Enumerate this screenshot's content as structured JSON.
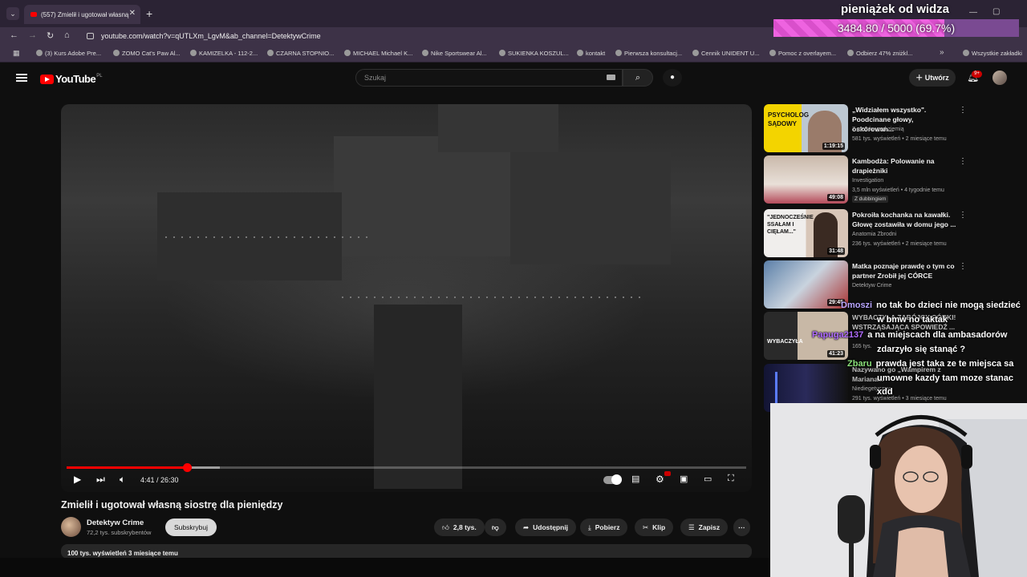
{
  "browser": {
    "tab_title": "(557) Zmielił i ugotował własną",
    "url": "youtube.com/watch?v=qUTLXm_LgvM&ab_channel=DetektywCrime",
    "bookmarks": [
      "(3) Kurs Adobe Pre...",
      "ZOMO Cat's Paw Al...",
      "KAMIZELKA - 112-2...",
      "CZARNA STOPNIO...",
      "MICHAEL Michael K...",
      "Nike Sportswear Al...",
      "SUKIENKA KOSZUL...",
      "kontakt",
      "Pierwsza konsultacj...",
      "Cennik UNIDENT U...",
      "Pomoc z overlayem...",
      "Odbierz 47% zniżkl...",
      "Wszystkie zakładki"
    ]
  },
  "overlay": {
    "title": "pieniążek od widza",
    "progress_text": "3484.80 / 5000 (69.7%)",
    "progress": 0.697
  },
  "youtube": {
    "logo": "YouTube",
    "region": "PL",
    "search_placeholder": "Szukaj",
    "create_label": "Utwórz",
    "notif_count": "9+"
  },
  "player": {
    "time": "4:41 / 26:30",
    "progress": 0.177,
    "buffered": 0.225
  },
  "video": {
    "title": "Zmielił i ugotował własną siostrę dla pieniędzy",
    "channel": "Detektyw Crime",
    "subs": "72,2 tys. subskrybentów",
    "subscribe_label": "Subskrybuj",
    "likes": "2,8 tys.",
    "share_label": "Udostępnij",
    "download_label": "Pobierz",
    "clip_label": "Klip",
    "save_label": "Zapisz",
    "desc_meta": "100 tys. wyświetleń  3 miesiące temu"
  },
  "recommendations": [
    {
      "title": "„Widziałem wszystko\". Poodcinane głowy, oskórowan...",
      "channel": "7 metrów pod ziemią",
      "meta": "581 tys. wyświetleń • 2 miesiące temu",
      "duration": "1:19:15",
      "thumb_text": "PSYCHOLOG SĄDOWY"
    },
    {
      "title": "Kambodża: Polowanie na drapieżniki",
      "channel": "Investigation",
      "meta": "3,5 mln wyświetleń • 4 tygodnie temu",
      "duration": "49:08",
      "dubbed": "Z dubbingiem"
    },
    {
      "title": "Pokroiła kochanka na kawałki. Głowę zostawiła w domu jego ...",
      "channel": "Anatomia Zbrodni",
      "meta": "236 tys. wyświetleń • 2 miesiące temu",
      "duration": "31:48",
      "thumb_text": "\"JEDNOCZEŚNIE SSAŁAM I CIĘŁAM...\""
    },
    {
      "title": "Matka poznaje prawdę o tym co partner Zrobił jej CÓRCE",
      "channel": "Detektyw Crime",
      "meta": "",
      "duration": "29:45"
    },
    {
      "title": "WYBACZYŁA ZABÓJCY CÓRKI! WSTRZĄSAJĄCA SPOWIEDŹ ...",
      "channel": "",
      "meta": "165 tys.",
      "duration": "41:23",
      "thumb_text": "WYBACZYŁA"
    },
    {
      "title": "Nazywano go „Wampirem z Mariana...",
      "channel": "Niediegetyczny",
      "meta": "291 tys. wyświetleń • 3 miesiące temu",
      "duration": ""
    }
  ],
  "chat": [
    {
      "user": "Dmoszi",
      "user_color": "#b9a6ff",
      "message": "no tak bo dzieci nie mogą siedzieć"
    },
    {
      "user": "",
      "user_color": "#ffffff",
      "message": "w bmw no taktak"
    },
    {
      "user": "Papuga2137",
      "user_color": "#b06bff",
      "message": "a na miejscach dla ambasadorów"
    },
    {
      "user": "",
      "user_color": "#ffffff",
      "message": "zdarzyło się stanąć ?"
    },
    {
      "user": "Zbaru",
      "user_color": "#8ae07a",
      "message": "prawda jest taka ze te miejsca sa"
    },
    {
      "user": "",
      "user_color": "#ffffff",
      "message": "umowne kazdy tam moze stanac"
    },
    {
      "user": "",
      "user_color": "#ffffff",
      "message": "xdd"
    }
  ]
}
